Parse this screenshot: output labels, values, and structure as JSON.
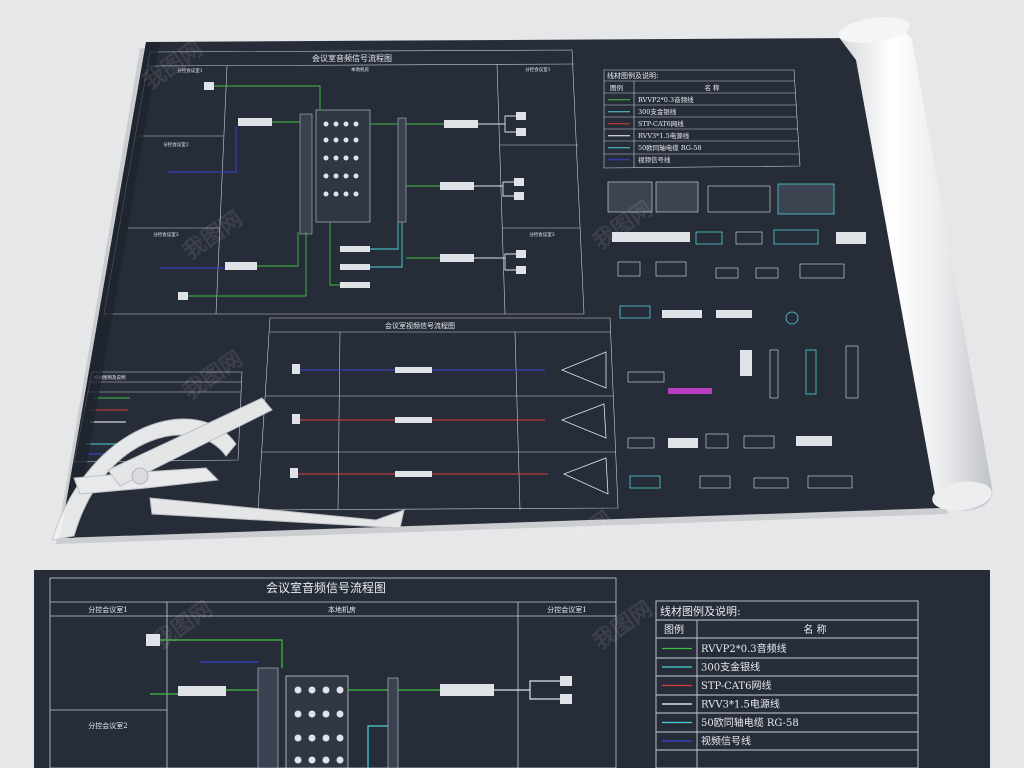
{
  "top_sheet": {
    "audio_title": "会议室音频信号流程图",
    "audio_sections": [
      "分控会议室1",
      "本地机房",
      "分控会议室1"
    ],
    "left_rooms": [
      "分控会议室2",
      "分控会议室3"
    ],
    "right_room": "分控会议室3",
    "legend_title": "线材图例及说明:",
    "legend_header": {
      "col1": "图例",
      "col2": "名  称"
    },
    "legend_items": [
      {
        "label": "RVVP2*0.3音频线",
        "color": "#3fbf3f"
      },
      {
        "label": "300支金银线",
        "color": "#4fd3d8"
      },
      {
        "label": "STP-CAT6网线",
        "color": "#d94040"
      },
      {
        "label": "RVV3*1.5电源线",
        "color": "#ffffff"
      },
      {
        "label": "50欧同轴电缆 RG-58",
        "color": "#4fd3d8"
      },
      {
        "label": "视频信号线",
        "color": "#3a45d8"
      }
    ],
    "video_title": "会议室视频信号流程图",
    "left_small_title": "线材图例及说明"
  },
  "bottom_sheet": {
    "audio_title": "会议室音频信号流程图",
    "sections": [
      "分控会议室1",
      "本地机房",
      "分控会议室1"
    ],
    "left_room_2": "分控会议室2",
    "legend_title": "线材图例及说明:",
    "legend_header": {
      "col1": "图例",
      "col2": "名  称"
    },
    "legend_items": [
      {
        "label": "RVVP2*0.3音频线",
        "color": "#3fbf3f"
      },
      {
        "label": "300支金银线",
        "color": "#4fd3d8"
      },
      {
        "label": "STP-CAT6网线",
        "color": "#d94040"
      },
      {
        "label": "RVV3*1.5电源线",
        "color": "#ffffff"
      },
      {
        "label": "50欧同轴电缆 RG-58",
        "color": "#4fd3d8"
      },
      {
        "label": "视频信号线",
        "color": "#3a45d8"
      }
    ]
  },
  "colors": {
    "background": "#e6e7e9",
    "sheet": "#262c38",
    "line": "#c9ced6",
    "green_wire": "#3fbf3f",
    "cyan_wire": "#4fd3d8",
    "red_wire": "#d94040",
    "blue_wire": "#3a45d8"
  },
  "watermark_text": "我图网"
}
